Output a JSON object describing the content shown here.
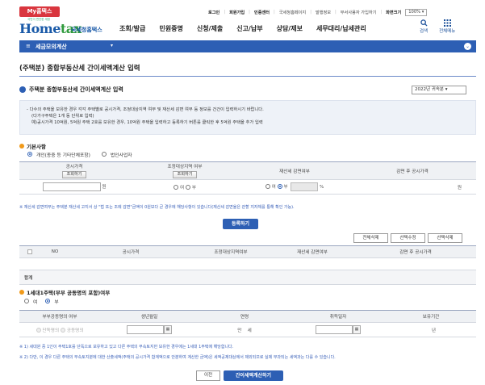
{
  "top": {
    "my_tab": "My홈택스",
    "util_links": [
      "로그인",
      "회원가입",
      "인증센터",
      "국세청홈페이지",
      "발행정보",
      "부서사용자 가입하기",
      "화면크기"
    ],
    "zoom": "100%"
  },
  "header": {
    "logo_small": "국민이 편안한 세정",
    "logo_main": "Hometax",
    "logo_sub": "국세청홈택스",
    "nav": [
      "조회/발급",
      "민원증명",
      "신청/제출",
      "신고/납부",
      "상담/제보",
      "세무대리/납세관리"
    ],
    "search_label": "검색",
    "allmenu_label": "전체메뉴"
  },
  "bluebar": {
    "title": "세금모의계산"
  },
  "page": {
    "title": "(주택분) 종합부동산세 간이세액계산 입력",
    "section_title": "주택분 종합부동산세 간이세액계산 입력",
    "year_select": "2022년 귀속분",
    "notice": [
      "- 다수의 주택을 보유한 경우 각각 주택별로 공시가격, 조정대상지역 여부 및 재산세 감면 여부 등 정보를 건건이 입력하시기 바랍니다.",
      "(다가구주택은 1개 동 단위로 입력)",
      "예)공시가격 10억원, 5억원 주택 2호를 보유한 경우, 10억원 주택을 입력하고 등록하기 버튼를 클릭한 후 5억원 주택을 추가 입력"
    ]
  },
  "basic": {
    "title": "기본사항",
    "type_individual": "개인(종중 등 기타단체포함)",
    "type_corp": "법인사업자",
    "headers": [
      "공시가격",
      "조정대상지역 여부",
      "재산세 감면여부",
      "감면 후 공시가격"
    ],
    "lookup_btn": "조회하기",
    "won": "원",
    "percent": "%",
    "yes": "여",
    "no": "부",
    "note": "※ 재산세 감면여부는 주택분 재산세 고지서 상 \"법 또는 조례 감면\"금액이 0원보다 큰 경우에 해당사항이 있습니다(재산세 감면율은 관할 지자체를 통해 확인 가능).",
    "register_btn": "등록하기"
  },
  "list": {
    "buttons": [
      "전체삭제",
      "선택수정",
      "선택삭제"
    ],
    "headers": [
      "NO",
      "공시가격",
      "조정대상지역여부",
      "재산세 감면여부",
      "감면 후 공시가격"
    ],
    "total_label": "합계"
  },
  "single": {
    "title": "1세대1주택(부부 공동명의 포함)여부",
    "yes": "여",
    "no": "부",
    "headers": [
      "부부공동명의 여부",
      "생년월일",
      "연령",
      "취득일자",
      "보유기간"
    ],
    "sole": "단독명의",
    "joint": "공동명의",
    "age_prefix": "만",
    "age_unit": "세",
    "years": "년",
    "notes": [
      "※ 1) 세대원 중 1인이 주택1호를 단독으로 보유하고 있고 다른 주택의 부속토지만 보유한 경우에는 1세대 1주택에 해당합니다.",
      "※ 2) 다만, 이 경우 다른 주택의 부속토지분에 대한 산출세액(주택의 공시가격 합계액으로 안분하여 계산한 금액)은 세액공제대상에서 제외되므로 실제 부과되는 세액과는 다를 수 있습니다."
    ]
  },
  "footer": {
    "prev_btn": "이전",
    "calc_btn": "간이세액계산하기"
  },
  "colors": {
    "brand_blue": "#2d5fb4",
    "accent_red": "#d9363e",
    "accent_orange": "#f19a1a"
  }
}
